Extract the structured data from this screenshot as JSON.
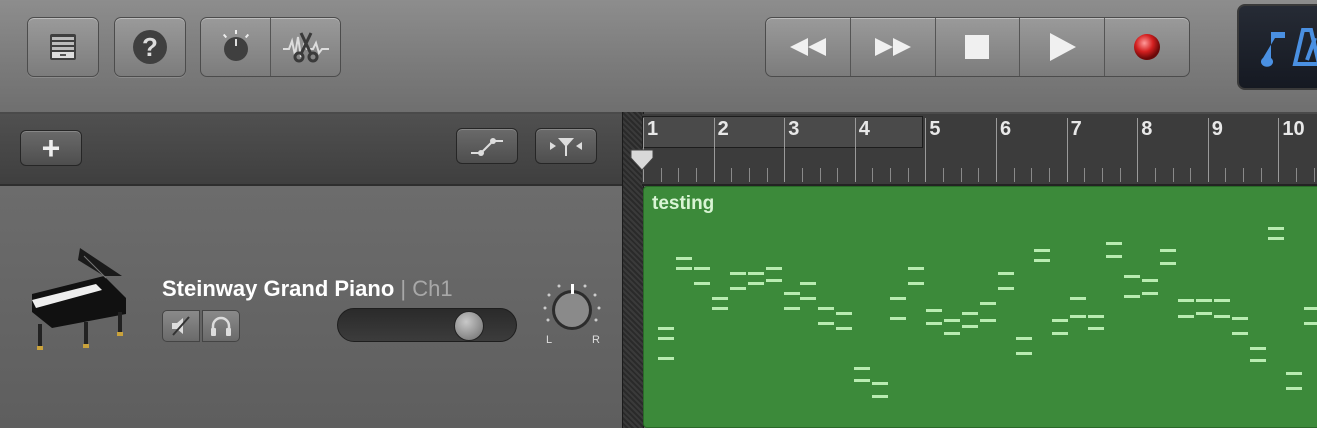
{
  "toolbar": {
    "icons": [
      "library-icon",
      "help-icon",
      "smart-controls-icon",
      "editors-icon",
      "rewind-icon",
      "fast-forward-icon",
      "stop-icon",
      "play-icon",
      "record-icon",
      "metronome-icon"
    ],
    "help_glyph": "?"
  },
  "tracks_header": {
    "add_glyph": "+"
  },
  "ruler": {
    "bars": [
      "1",
      "2",
      "3",
      "4",
      "5",
      "6",
      "7",
      "8",
      "9",
      "10"
    ]
  },
  "track": {
    "name": "Steinway Grand Piano",
    "separator": "|",
    "channel": "Ch1",
    "pan_left": "L",
    "pan_right": "R",
    "volume_level": 0.78
  },
  "region": {
    "name": "testing",
    "color": "#3c8a3a",
    "note_color": "#b9ecb1"
  },
  "colors": {
    "record": "#d42020",
    "lcd_icon": "#4a90e2"
  }
}
